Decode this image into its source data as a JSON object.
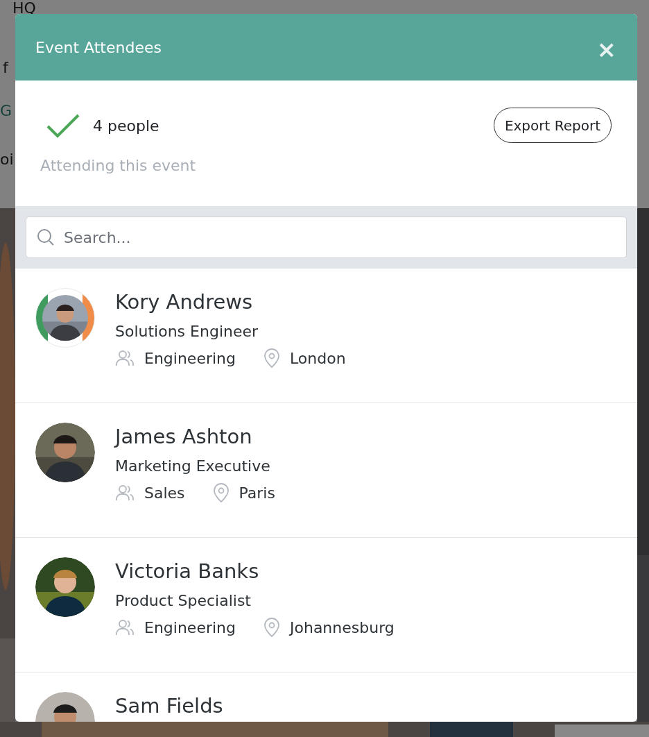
{
  "background": {
    "texts": [
      {
        "kind": "plain",
        "text": "HQ"
      },
      {
        "kind": "plain",
        "text": "f"
      },
      {
        "kind": "link",
        "text": "G"
      },
      {
        "kind": "plain",
        "text": "oi"
      }
    ]
  },
  "modal": {
    "title": "Event Attendees",
    "close": "×",
    "summary": {
      "count": "4 people",
      "caption": "Attending this event",
      "export": "Export Report"
    },
    "search": {
      "placeholder": "Search..."
    },
    "people": [
      {
        "name": "Kory Andrews",
        "title": "Solutions Engineer",
        "department": "Engineering",
        "location": "London",
        "highlighted": true
      },
      {
        "name": "James Ashton",
        "title": "Marketing Executive",
        "department": "Sales",
        "location": "Paris",
        "highlighted": false
      },
      {
        "name": "Victoria Banks",
        "title": "Product Specialist",
        "department": "Engineering",
        "location": "Johannesburg",
        "highlighted": false
      },
      {
        "name": "Sam Fields",
        "highlighted": false
      }
    ]
  }
}
